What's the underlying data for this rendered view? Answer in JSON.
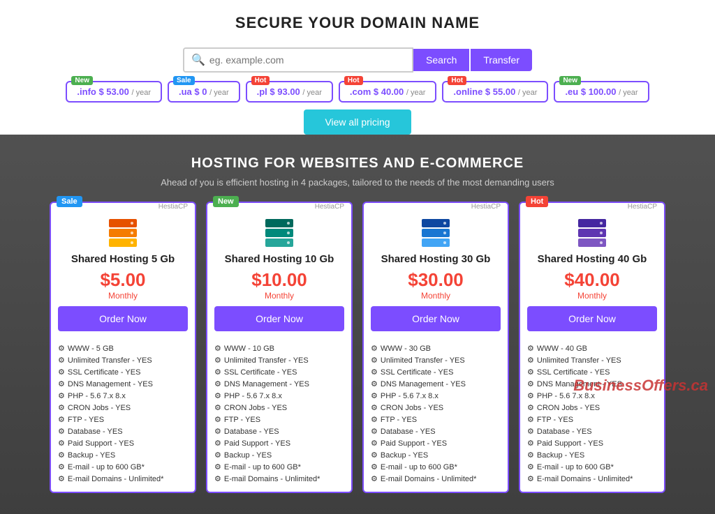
{
  "header": {
    "title": "SECURE YOUR DOMAIN NAME"
  },
  "search": {
    "placeholder": "eg. example.com",
    "btn_search": "Search",
    "btn_transfer": "Transfer"
  },
  "domain_pills": [
    {
      "badge": "New",
      "badge_type": "new",
      "tld": ".info",
      "price": "$ 53.00",
      "per_year": "/ year"
    },
    {
      "badge": "Sale",
      "badge_type": "sale",
      "tld": ".ua",
      "price": "$ 0",
      "per_year": "/ year"
    },
    {
      "badge": "Hot",
      "badge_type": "hot",
      "tld": ".pl",
      "price": "$ 93.00",
      "per_year": "/ year"
    },
    {
      "badge": "Hot",
      "badge_type": "hot",
      "tld": ".com",
      "price": "$ 40.00",
      "per_year": "/ year"
    },
    {
      "badge": "Hot",
      "badge_type": "hot",
      "tld": ".online",
      "price": "$ 55.00",
      "per_year": "/ year"
    },
    {
      "badge": "New",
      "badge_type": "new",
      "tld": ".eu",
      "price": "$ 100.00",
      "per_year": "/ year"
    }
  ],
  "view_all_label": "View all pricing",
  "hosting": {
    "title": "HOSTING FOR WEBSITES AND E-COMMERCE",
    "subtitle": "Ahead of you is efficient hosting in 4 packages, tailored to the needs of the most demanding users",
    "cards": [
      {
        "badge": "Sale",
        "badge_type": "sale",
        "brand": "HestiaCP",
        "title": "Shared Hosting 5 Gb",
        "price": "$5.00",
        "monthly": "Monthly",
        "btn": "Order Now",
        "features": [
          "WWW - 5 GB",
          "Unlimited Transfer - YES",
          "SSL Certificate - YES",
          "DNS Management - YES",
          "PHP - 5.6 7.x 8.x",
          "CRON Jobs - YES",
          "FTP - YES",
          "Database - YES",
          "Paid Support - YES",
          "Backup - YES",
          "E-mail - up to 600 GB*",
          "E-mail Domains - Unlimited*"
        ]
      },
      {
        "badge": "New",
        "badge_type": "new",
        "brand": "HestiaCP",
        "title": "Shared Hosting 10 Gb",
        "price": "$10.00",
        "monthly": "Monthly",
        "btn": "Order Now",
        "features": [
          "WWW - 10 GB",
          "Unlimited Transfer - YES",
          "SSL Certificate - YES",
          "DNS Management - YES",
          "PHP - 5.6 7.x 8.x",
          "CRON Jobs - YES",
          "FTP - YES",
          "Database - YES",
          "Paid Support - YES",
          "Backup - YES",
          "E-mail - up to 600 GB*",
          "E-mail Domains - Unlimited*"
        ]
      },
      {
        "badge": null,
        "badge_type": null,
        "brand": "HestiaCP",
        "title": "Shared Hosting 30 Gb",
        "price": "$30.00",
        "monthly": "Monthly",
        "btn": "Order Now",
        "features": [
          "WWW - 30 GB",
          "Unlimited Transfer - YES",
          "SSL Certificate - YES",
          "DNS Management - YES",
          "PHP - 5.6 7.x 8.x",
          "CRON Jobs - YES",
          "FTP - YES",
          "Database - YES",
          "Paid Support - YES",
          "Backup - YES",
          "E-mail - up to 600 GB*",
          "E-mail Domains - Unlimited*"
        ]
      },
      {
        "badge": "Hot",
        "badge_type": "hot",
        "brand": "HestiaCP",
        "title": "Shared Hosting 40 Gb",
        "price": "$40.00",
        "monthly": "Monthly",
        "btn": "Order Now",
        "features": [
          "WWW - 40 GB",
          "Unlimited Transfer - YES",
          "SSL Certificate - YES",
          "DNS Management - YES",
          "PHP - 5.6 7.x 8.x",
          "CRON Jobs - YES",
          "FTP - YES",
          "Database - YES",
          "Paid Support - YES",
          "Backup - YES",
          "E-mail - up to 600 GB*",
          "E-mail Domains - Unlimited*"
        ]
      }
    ]
  },
  "watermark": "BusinessOffers.ca"
}
